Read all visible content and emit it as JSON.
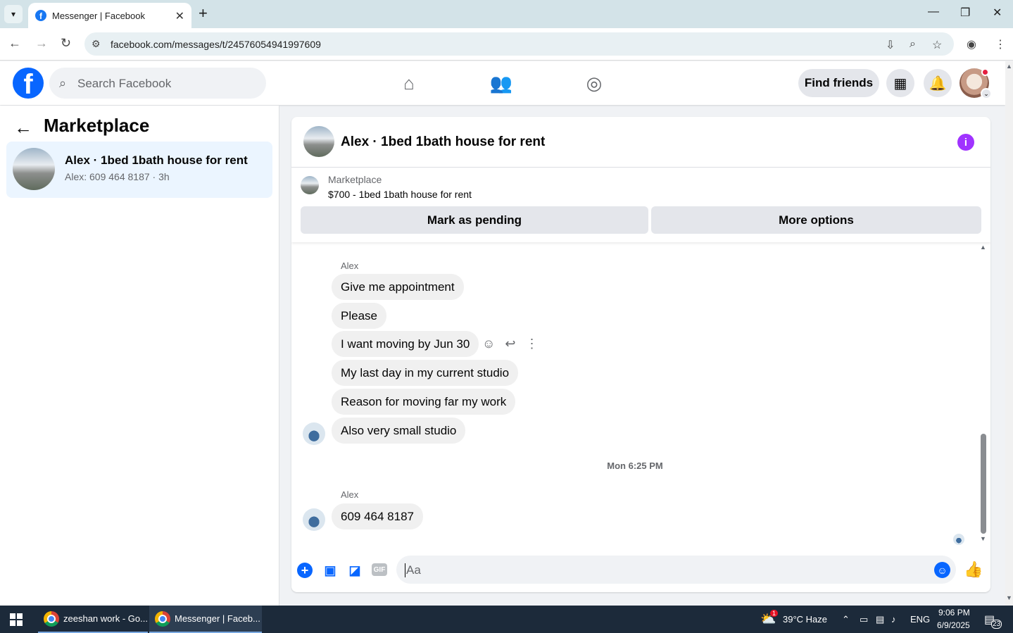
{
  "browser": {
    "tab_title": "Messenger | Facebook",
    "url": "facebook.com/messages/t/24576054941997609"
  },
  "fb_header": {
    "search_placeholder": "Search Facebook",
    "find_friends": "Find friends"
  },
  "left_panel": {
    "title": "Marketplace",
    "conversation": {
      "name": "Alex · 1bed 1bath house for rent",
      "subtitle": "Alex: 609 464 8187 · 3h"
    }
  },
  "chat": {
    "title": "Alex · 1bed 1bath house for rent",
    "listing": {
      "source": "Marketplace",
      "title": "$700 - 1bed 1bath house for rent",
      "pending_label": "Mark as pending",
      "more_label": "More options"
    },
    "messages_group1": {
      "sender": "Alex",
      "items": [
        "Give me appointment",
        "Please",
        "I want moving by Jun 30",
        "My last day in my current studio",
        "Reason for moving far my work",
        "Also very small studio"
      ]
    },
    "timestamp": "Mon 6:25 PM",
    "messages_group2": {
      "sender": "Alex",
      "items": [
        "609 464 8187"
      ]
    },
    "composer_placeholder": "Aa",
    "gif_label": "GIF"
  },
  "taskbar": {
    "item1": "zeeshan work - Go...",
    "item2": "Messenger | Faceb...",
    "weather": "39°C  Haze",
    "lang": "ENG",
    "time": "9:06 PM",
    "date": "6/9/2025",
    "notif_count": "23",
    "weather_badge": "1"
  },
  "colors": {
    "fb_blue": "#0866ff",
    "bubble_bg": "#f0f0f0",
    "info_purple": "#a033ff",
    "selected_conv_bg": "#ebf5ff"
  }
}
